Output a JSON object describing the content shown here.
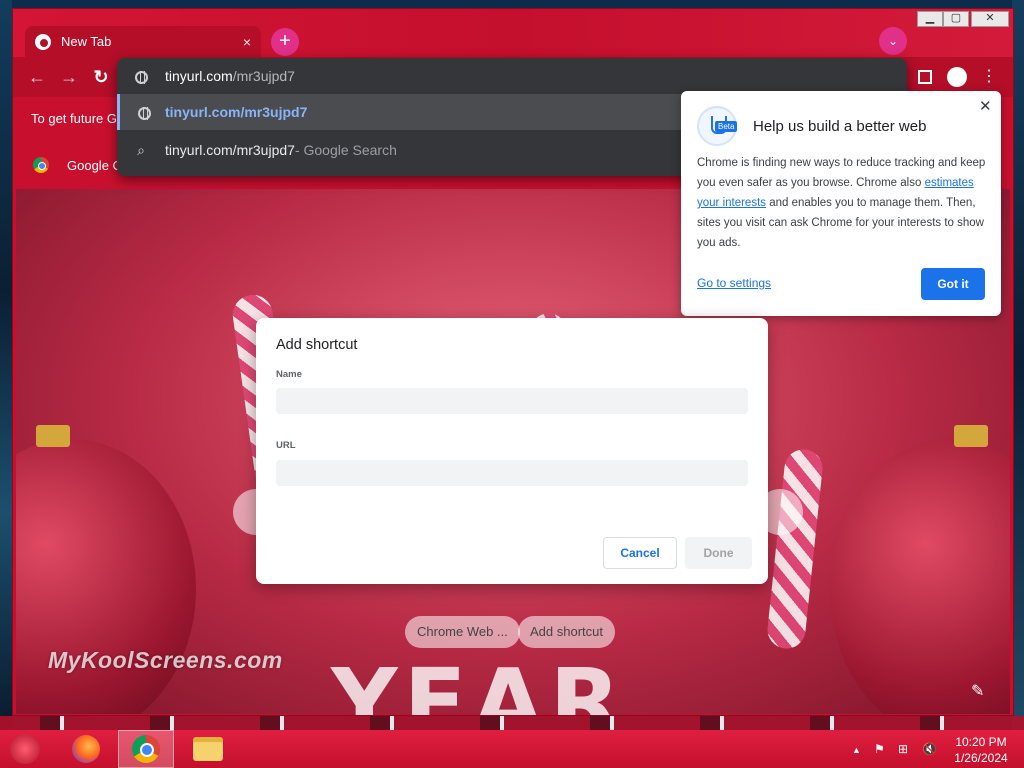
{
  "browser": {
    "tab_title": "New Tab",
    "tab_close_glyph": "×",
    "new_tab_glyph": "+",
    "tab_search_glyph": "⌄"
  },
  "window_controls": {
    "minimize": "▁",
    "maximize": "▢",
    "close": "✕"
  },
  "toolbar": {
    "back_glyph": "←",
    "forward_glyph": "→",
    "reload_glyph": "↻",
    "menu_glyph": "⋮"
  },
  "omnibox": {
    "input_host": "tinyurl.com",
    "input_path": "/mr3ujpd7",
    "suggestion_url": "tinyurl.com/mr3ujpd7",
    "suggestion_search_query": "tinyurl.com/mr3ujpd7",
    "suggestion_search_provider": " - Google Search"
  },
  "infobar": {
    "text": "To get future G"
  },
  "shortcuts": {
    "google_label": "Google C"
  },
  "privacy_bubble": {
    "title": "Help us build a better web",
    "beta_tag": "Beta",
    "body_before_link": "Chrome is finding new ways to reduce tracking and keep you even safer as you browse. Chrome also ",
    "body_link": "estimates your interests",
    "body_after_link": " and enables you to manage them. Then, sites you visit can ask Chrome for your interests to show you ads.",
    "settings_link": "Go to settings",
    "got_it": "Got it",
    "close_glyph": "✕"
  },
  "add_shortcut_dialog": {
    "title": "Add shortcut",
    "name_label": "Name",
    "name_value": "",
    "url_label": "URL",
    "url_value": "",
    "cancel": "Cancel",
    "done": "Done"
  },
  "ntp": {
    "chrome_web_store_button": "Chrome Web ...",
    "add_shortcut_button": "Add shortcut",
    "watermark": "MyKoolScreens.com",
    "background_text": "YEAR",
    "customize_glyph": "✎"
  },
  "taskbar": {
    "time": "10:20 PM",
    "date": "1/26/2024",
    "tray_up_glyph": "▲",
    "flag_glyph": "⚑",
    "network_glyph": "⊞",
    "volume_glyph": "🔇"
  },
  "colors": {
    "theme_red": "#c8102e",
    "omnibox_dark": "#35363a",
    "link_blue": "#1a73e8",
    "suggest_blue": "#8ab4f8"
  }
}
